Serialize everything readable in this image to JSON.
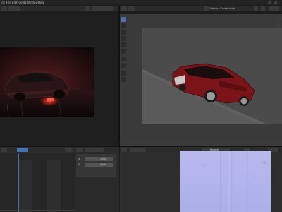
{
  "topbar": {
    "menus": [
      "File",
      "Edit",
      "Render",
      "Window",
      "Help"
    ]
  },
  "viewport": {
    "title": "Camera Perspective"
  },
  "props_panel": {
    "label_x": "X",
    "label_y": "Y",
    "value_x": "1.000",
    "value_y": "0.000"
  },
  "image_editor": {
    "image_name": "Normal"
  },
  "colors": {
    "accent": "#4772b3",
    "car_red": "#8a1a1e",
    "normal_map": "#b5b7ec"
  }
}
